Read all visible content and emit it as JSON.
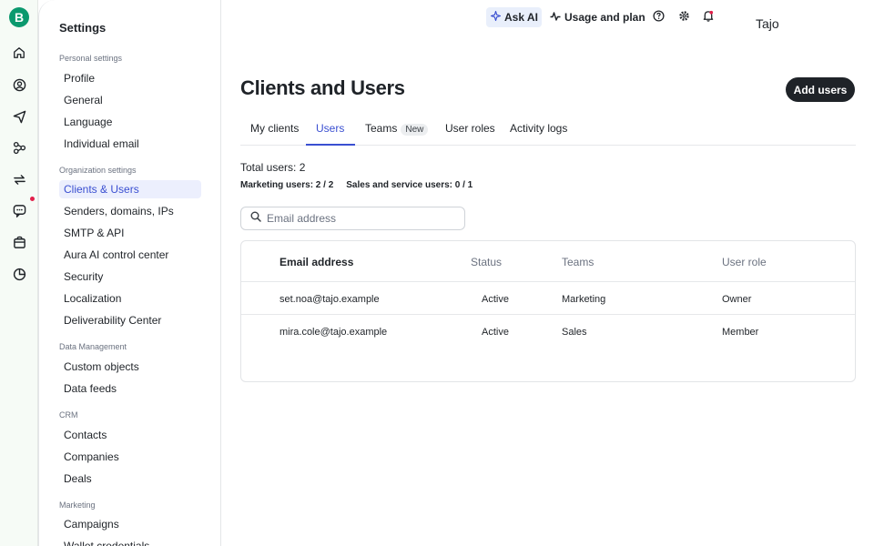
{
  "rail": {
    "logo_letter": "B",
    "icons": [
      "home-icon",
      "contacts-icon",
      "send-icon",
      "automation-icon",
      "transactional-icon",
      "conversations-icon",
      "sales-icon",
      "meetings-icon"
    ]
  },
  "sidebar": {
    "title": "Settings",
    "sections": [
      {
        "label": "Personal settings",
        "items": [
          "Profile",
          "General",
          "Language",
          "Individual email"
        ]
      },
      {
        "label": "Organization settings",
        "items": [
          "Clients & Users",
          "Senders, domains, IPs",
          "SMTP & API",
          "Aura AI control center",
          "Security",
          "Localization",
          "Deliverability Center"
        ]
      },
      {
        "label": "Data Management",
        "items": [
          "Custom objects",
          "Data feeds"
        ]
      },
      {
        "label": "CRM",
        "items": [
          "Contacts",
          "Companies",
          "Deals"
        ]
      },
      {
        "label": "Marketing",
        "items": [
          "Campaigns",
          "Wallet credentials"
        ]
      }
    ],
    "active_item": "Clients & Users"
  },
  "topbar": {
    "ask_ai": "Ask AI",
    "usage": "Usage and plan",
    "user": "Tajo"
  },
  "main": {
    "title": "Clients and Users",
    "add_button": "Add users",
    "tabs": [
      {
        "label": "My clients"
      },
      {
        "label": "Users",
        "active": true
      },
      {
        "label": "Teams",
        "badge": "New"
      },
      {
        "label": "User roles"
      },
      {
        "label": "Activity logs"
      }
    ],
    "total_users": "Total users: 2",
    "marketing_users": "Marketing users: 2 / 2",
    "sales_users": "Sales and service users: 0 / 1",
    "search": {
      "placeholder": "Email address",
      "value": ""
    },
    "table": {
      "headers": [
        "Email address",
        "Status",
        "Teams",
        "User role"
      ],
      "rows": [
        [
          "set.noa@tajo.example",
          "Active",
          "Marketing",
          "Owner"
        ],
        [
          "mira.cole@tajo.example",
          "Active",
          "Sales",
          "Member"
        ]
      ]
    }
  },
  "colors": {
    "accent": "#3a4fd1",
    "brand": "#0b996e",
    "dark_button": "#1f2328",
    "notification_dot": "#e2204b"
  }
}
